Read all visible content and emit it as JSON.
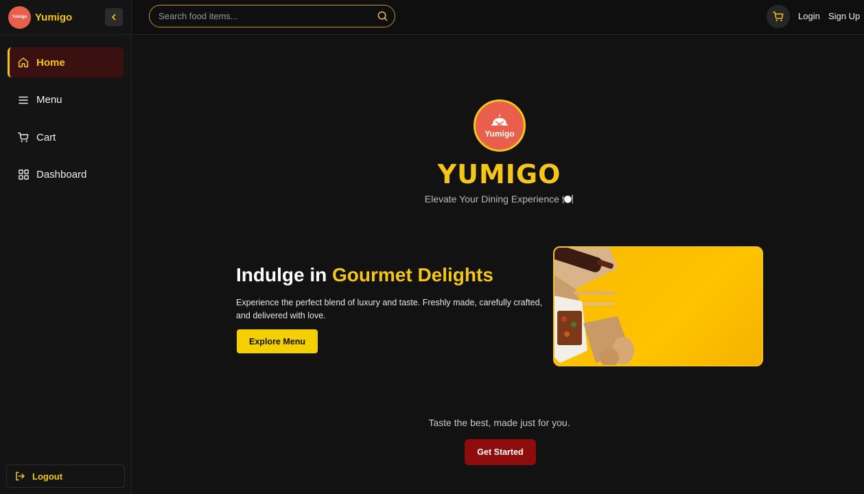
{
  "sidebar": {
    "logo_text": "Yumigo",
    "brand": "Yumigo",
    "items": [
      {
        "label": "Home",
        "icon": "home-icon",
        "active": true
      },
      {
        "label": "Menu",
        "icon": "menu-icon",
        "active": false
      },
      {
        "label": "Cart",
        "icon": "cart-icon",
        "active": false
      },
      {
        "label": "Dashboard",
        "icon": "dashboard-icon",
        "active": false
      }
    ],
    "logout_label": "Logout"
  },
  "topbar": {
    "search_placeholder": "Search food items...",
    "login_label": "Login",
    "signup_label": "Sign Up"
  },
  "hero": {
    "logo_text": "Yumigo",
    "title": "YUMIGO",
    "subtitle": "Elevate Your Dining Experience 🍽️",
    "headline_prefix": "Indulge in ",
    "headline_highlight": "Gourmet Delights",
    "description": "Experience the perfect blend of luxury and taste. Freshly made, carefully crafted, and delivered with love.",
    "explore_label": "Explore Menu",
    "tagline": "Taste the best, made just for you.",
    "cta_label": "Get Started"
  },
  "colors": {
    "accent": "#f5c518",
    "brand_red": "#e8604c",
    "cta": "#8f0c0c",
    "background": "#121212"
  }
}
